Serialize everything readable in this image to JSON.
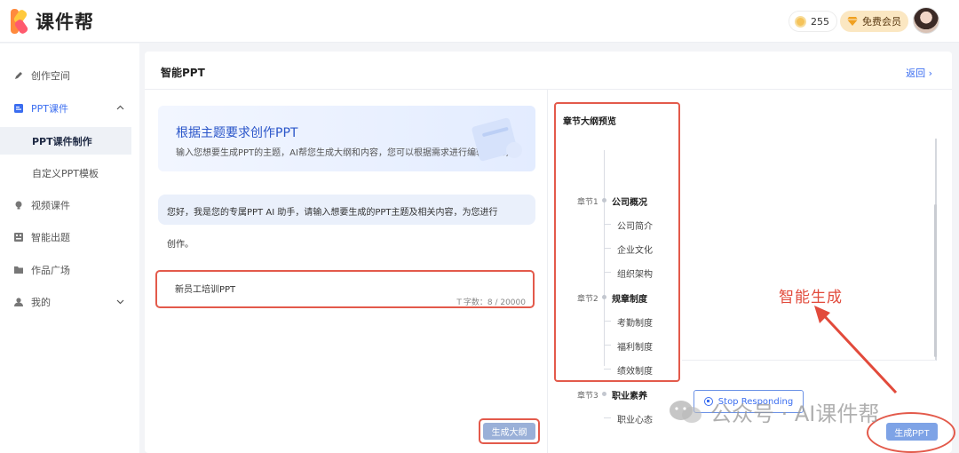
{
  "app": {
    "name": "课件帮"
  },
  "header": {
    "coins": "255",
    "vip_label": "免费会员"
  },
  "sidebar": {
    "items": [
      {
        "label": "创作空间",
        "icon": "pen-icon"
      },
      {
        "label": "PPT课件",
        "icon": "ppt-icon",
        "expanded": true
      },
      {
        "label": "视频课件",
        "icon": "bulb-icon"
      },
      {
        "label": "智能出题",
        "icon": "grid-icon"
      },
      {
        "label": "作品广场",
        "icon": "folder-icon"
      },
      {
        "label": "我的",
        "icon": "user-icon"
      }
    ],
    "sub_items": [
      {
        "label": "PPT课件制作",
        "active": true
      },
      {
        "label": "自定义PPT模板",
        "active": false
      }
    ]
  },
  "main": {
    "title": "智能PPT",
    "back_label": "返回 ›",
    "intro": {
      "title": "根据主题要求创作PPT",
      "text": "输入您想要生成PPT的主题，AI帮您生成大纲和内容，您可以根据需求进行编辑和修改"
    },
    "assistant_message_line1": "您好，我是您的专属PPT AI 助手，请输入想要生成的PPT主题及相关内容，为您进行",
    "assistant_message_line2": "创作。",
    "topic_value": "新员工培训PPT",
    "counter_icon": "T",
    "counter_text": "字数：8 / 20000",
    "outline_button": "生成大纲"
  },
  "outline": {
    "heading": "章节大纲预览",
    "chapters": [
      {
        "label": "章节1",
        "title": "公司概况",
        "subs": [
          "公司简介",
          "企业文化",
          "组织架构"
        ]
      },
      {
        "label": "章节2",
        "title": "规章制度",
        "subs": [
          "考勤制度",
          "福利制度",
          "绩效制度"
        ]
      },
      {
        "label": "章节3",
        "title": "职业素养",
        "subs": [
          "职业心态"
        ]
      }
    ]
  },
  "annotation": "智能生成",
  "stop_button": "Stop Responding",
  "generate_button": "生成PPT",
  "watermark": "公众号 · AI课件帮",
  "colors": {
    "accent": "#3a6df0",
    "highlight": "#e35a4b",
    "button": "#7ea3e6"
  }
}
